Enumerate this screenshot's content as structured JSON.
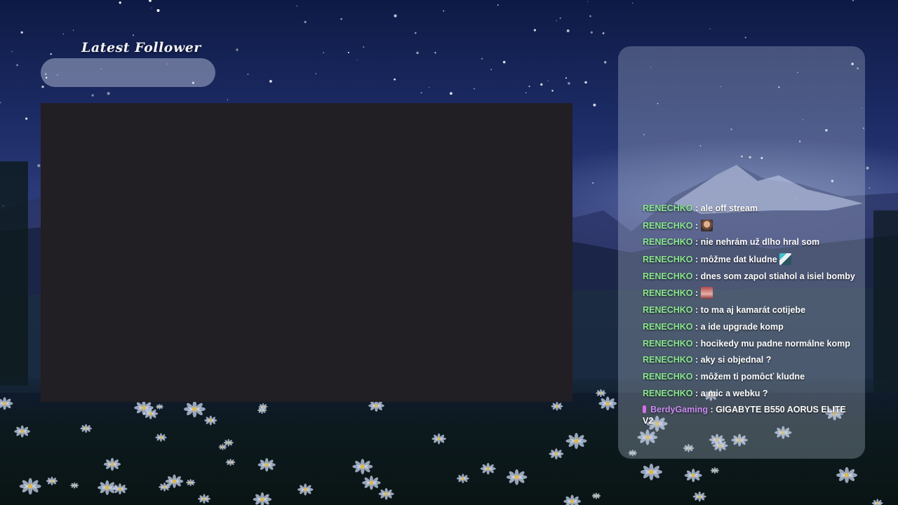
{
  "overlay": {
    "follower_title": "Latest Follower",
    "follower_value": ""
  },
  "chat": {
    "messages": [
      {
        "user": "RENECHKO",
        "sep": " : ",
        "text": "ale off stream"
      },
      {
        "user": "RENECHKO",
        "sep": " : ",
        "text": "",
        "emote": "face-emote-icon"
      },
      {
        "user": "RENECHKO",
        "sep": " : ",
        "text": "nie nehrám už dlho hral som"
      },
      {
        "user": "RENECHKO",
        "sep": " : ",
        "text": "môžme dat kludne ",
        "emote": "custom-emote-icon"
      },
      {
        "user": "RENECHKO",
        "sep": " : ",
        "text": "dnes som zapol stiahol a isiel bomby"
      },
      {
        "user": "RENECHKO",
        "sep": " : ",
        "text": "",
        "emote": "hand-emote-icon"
      },
      {
        "user": "RENECHKO",
        "sep": " : ",
        "text": "to ma aj kamarát cotijebe"
      },
      {
        "user": "RENECHKO",
        "sep": " : ",
        "text": "a ide upgrade komp"
      },
      {
        "user": "RENECHKO",
        "sep": " : ",
        "text": "hocikedy mu padne normálne komp"
      },
      {
        "user": "RENECHKO",
        "sep": " : ",
        "text": "aky si objednal ?"
      },
      {
        "user": "RENECHKO",
        "sep": " : ",
        "text": "môžem ti pomôcť kludne"
      },
      {
        "user": "RENECHKO",
        "sep": " : ",
        "text": "a mic a webku ?"
      },
      {
        "user": "BerdyGaming",
        "sep": " : ",
        "text": "GIGABYTE B550 AORUS ELITE V2",
        "badge": "subscriber-badge-icon"
      }
    ]
  },
  "colors": {
    "username": "#8ae88e",
    "username_alt": "#c98bf0",
    "chat_text": "#ffffff",
    "video_bg": "#211e24"
  }
}
